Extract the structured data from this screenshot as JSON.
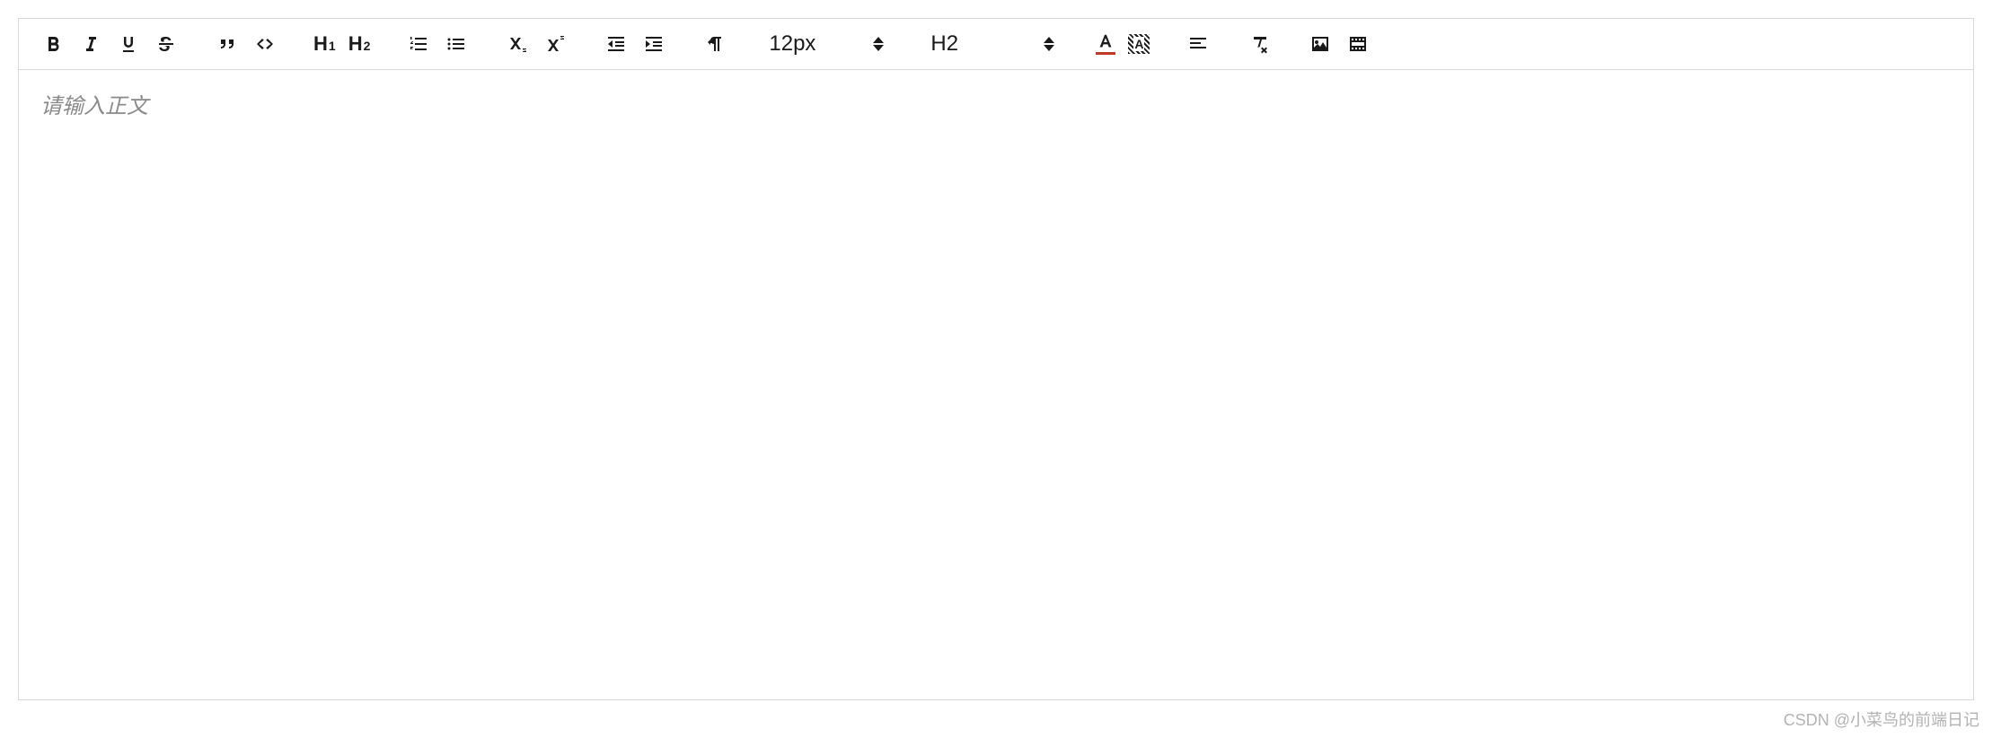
{
  "toolbar": {
    "heading1_label": "H",
    "heading1_sub": "1",
    "heading2_label": "H",
    "heading2_sub": "2",
    "font_size_value": "12px",
    "header_select_value": "H2",
    "font_color": "#c0392b",
    "bg_color": "#1a1a1a"
  },
  "editor": {
    "placeholder": "请输入正文",
    "content": ""
  },
  "watermark": "CSDN @小菜鸟的前端日记"
}
